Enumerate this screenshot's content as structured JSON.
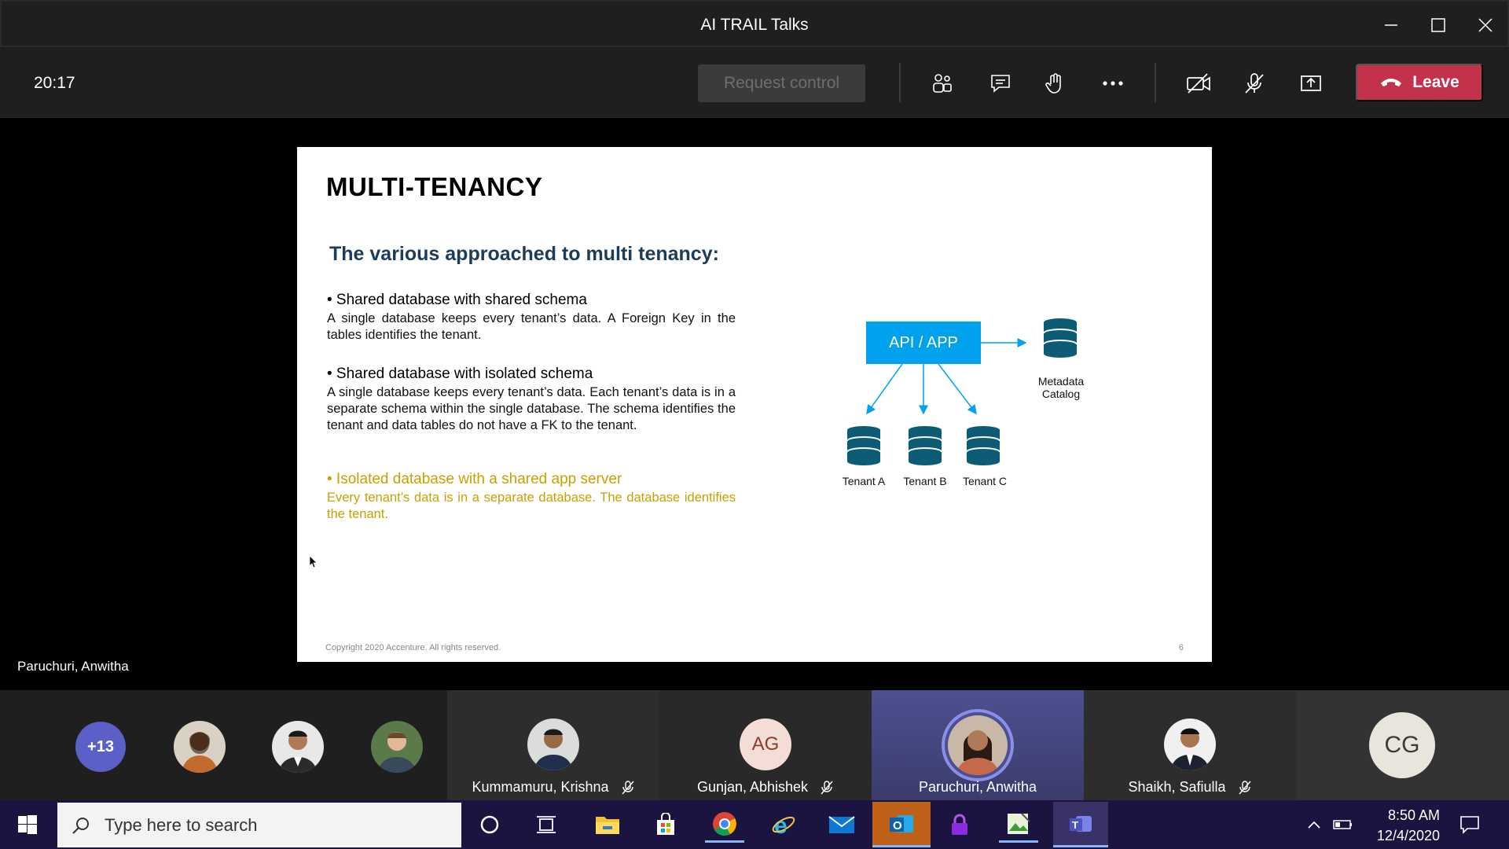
{
  "window": {
    "title": "AI TRAIL Talks"
  },
  "toolbar": {
    "timer": "20:17",
    "request_control": "Request control",
    "leave": "Leave"
  },
  "slide": {
    "heading": "MULTI-TENANCY",
    "subheading": "The various approached to multi tenancy:",
    "items": [
      {
        "title": "• Shared database with shared schema",
        "desc": "A single database keeps every tenant’s data. A Foreign Key in the tables identifies the tenant."
      },
      {
        "title": "• Shared database with isolated schema",
        "desc": "A single database keeps every tenant’s data. Each tenant’s data is in a separate schema within the single database. The schema identifies the tenant and data tables do not have a FK to the tenant."
      },
      {
        "title": "• Isolated database with a shared app server",
        "desc": "Every tenant’s data is in a separate database. The database identifies the tenant."
      }
    ],
    "diagram": {
      "api_box": "API / APP",
      "metadata": "Metadata Catalog",
      "tenant_a": "Tenant A",
      "tenant_b": "Tenant B",
      "tenant_c": "Tenant C"
    },
    "copyright": "Copyright 2020 Accenture. All rights reserved.",
    "page_number": "6"
  },
  "presenter_name": "Paruchuri, Anwitha",
  "participants": {
    "more_count": "+13",
    "tiles": [
      {
        "name": "Kummamuru, Krishna",
        "muted": true
      },
      {
        "name": "Gunjan, Abhishek",
        "initials": "AG",
        "muted": true
      },
      {
        "name": "Paruchuri, Anwitha",
        "muted": false
      },
      {
        "name": "Shaikh, Safiulla",
        "muted": true
      },
      {
        "initials": "CG"
      }
    ]
  },
  "taskbar": {
    "search_placeholder": "Type here to search",
    "time": "8:50 AM",
    "date": "12/4/2020"
  },
  "colors": {
    "accent_blue": "#00a2ed",
    "leave_red": "#c4314b",
    "highlight_gold": "#c8a100",
    "teams_purple": "#5b5fc7"
  }
}
